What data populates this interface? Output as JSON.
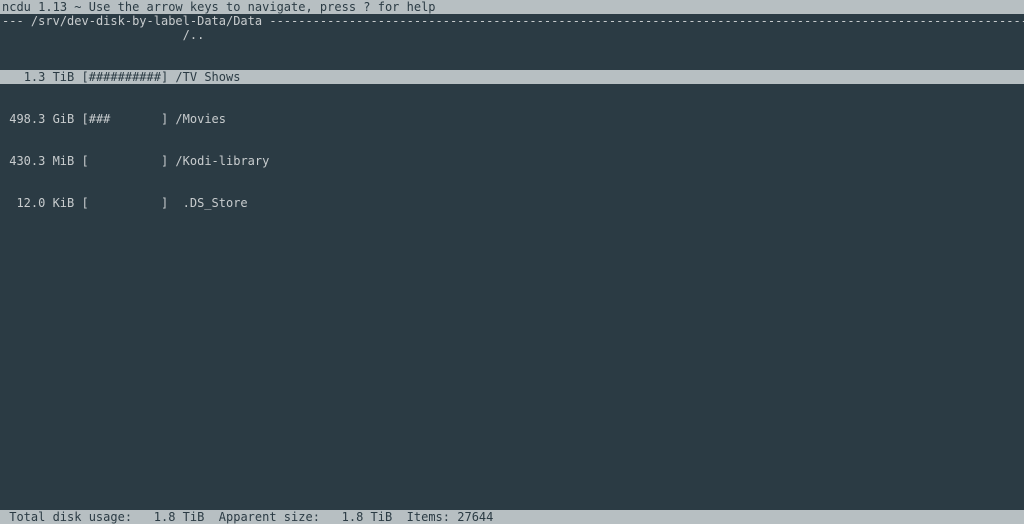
{
  "header": {
    "app_name": "ncdu",
    "version": "1.13",
    "help_hint": "Use the arrow keys to navigate, press ? for help"
  },
  "path": {
    "prefix": "---",
    "directory": "/srv/dev-disk-by-label-Data/Data"
  },
  "parent_dir": "/..",
  "entries": [
    {
      "size": "1.3 TiB",
      "bar": "##########",
      "name": "/TV Shows",
      "selected": true
    },
    {
      "size": "498.3 GiB",
      "bar": "###       ",
      "name": "/Movies",
      "selected": false
    },
    {
      "size": "430.3 MiB",
      "bar": "          ",
      "name": "/Kodi-library",
      "selected": false
    },
    {
      "size": "12.0 KiB",
      "bar": "          ",
      "name": " .DS_Store",
      "selected": false
    }
  ],
  "footer": {
    "total_label": "Total disk usage:",
    "total_value": "1.8 TiB",
    "apparent_label": "Apparent size:",
    "apparent_value": "1.8 TiB",
    "items_label": "Items:",
    "items_value": "27644"
  }
}
